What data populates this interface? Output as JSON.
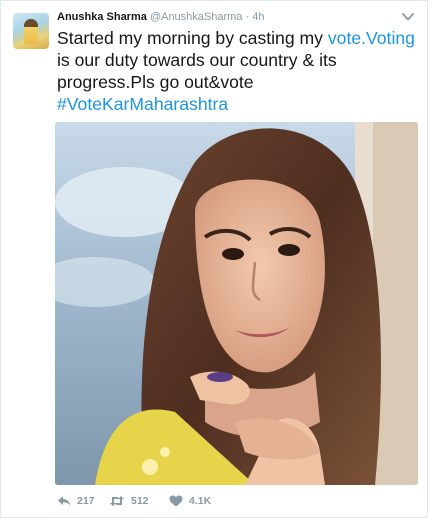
{
  "tweet": {
    "author_name": "Anushka Sharma",
    "author_handle": "@AnushkaSharma",
    "separator": "·",
    "time": "4h",
    "text_segments": [
      {
        "text": "Started my morning by casting my ",
        "type": "plain"
      },
      {
        "text": "vote.Voting",
        "type": "link"
      },
      {
        "text": " is our duty towards our country & its progress.Pls go out&vote ",
        "type": "plain"
      },
      {
        "text": "#VoteKarMaharashtra",
        "type": "hashtag"
      }
    ]
  },
  "actions": {
    "reply_icon": "reply-icon",
    "retweet_icon": "retweet-icon",
    "retweet_count": "217",
    "like_icon": "heart-icon",
    "like_count": "512",
    "more_icon": "more-icon",
    "more_count": "4.1K"
  },
  "colors": {
    "link": "#1b95e0",
    "muted": "#8899a6",
    "text": "#14171a",
    "border": "#e1e8ed"
  }
}
